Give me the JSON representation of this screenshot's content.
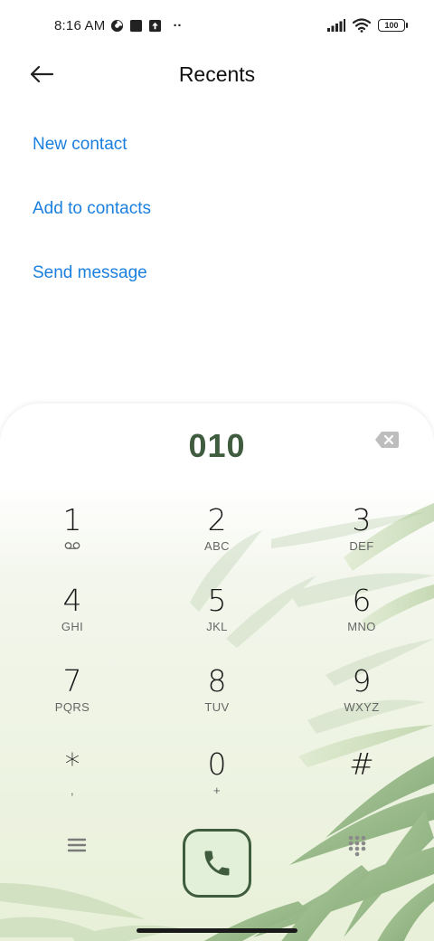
{
  "status_bar": {
    "time": "8:16 AM",
    "battery": "100",
    "more_dots": "··"
  },
  "header": {
    "title": "Recents"
  },
  "actions": {
    "new_contact": "New contact",
    "add_to_contacts": "Add to contacts",
    "send_message": "Send message"
  },
  "dialer": {
    "number": "010",
    "keys": [
      {
        "digit": "1",
        "letters": ""
      },
      {
        "digit": "2",
        "letters": "ABC"
      },
      {
        "digit": "3",
        "letters": "DEF"
      },
      {
        "digit": "4",
        "letters": "GHI"
      },
      {
        "digit": "5",
        "letters": "JKL"
      },
      {
        "digit": "6",
        "letters": "MNO"
      },
      {
        "digit": "7",
        "letters": "PQRS"
      },
      {
        "digit": "8",
        "letters": "TUV"
      },
      {
        "digit": "9",
        "letters": "WXYZ"
      },
      {
        "digit": "*",
        "letters": ","
      },
      {
        "digit": "0",
        "letters": "+"
      },
      {
        "digit": "#",
        "letters": ""
      }
    ]
  },
  "colors": {
    "accent": "#1a7fde",
    "number": "#3f5c3f",
    "call_border": "#3f5c3f"
  },
  "icons": {
    "back": "arrow-left-icon",
    "backspace": "backspace-icon",
    "voicemail": "voicemail-icon",
    "menu": "menu-icon",
    "call": "phone-icon",
    "keypad": "keypad-icon"
  }
}
